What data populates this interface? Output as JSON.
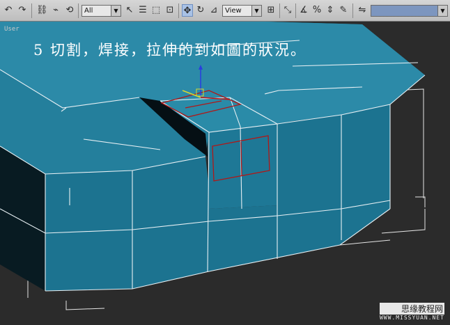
{
  "toolbar": {
    "icons": [
      "undo-icon",
      "redo-icon",
      "link-icon",
      "unlink-icon",
      "bind-spacewarp-icon",
      "select-icon",
      "select-by-name-icon",
      "region-select-icon",
      "window-crossing-icon",
      "move-icon",
      "rotate-icon",
      "scale-icon",
      "snap-icon",
      "spinner-snap-icon",
      "mirror-icon",
      "align-icon",
      "layer-icon",
      "curve-editor-icon"
    ],
    "selection_filter": "All",
    "reference_coord": "View",
    "named_selection": ""
  },
  "viewport": {
    "label": "User",
    "caption": "5  切割，焊接，拉伸的到如圖的狀況。"
  },
  "watermark": {
    "title": "思缘教程网",
    "url": "WWW.MISSYUAN.NET"
  },
  "colors": {
    "model_face": "#1d7895",
    "model_top": "#2a86a3",
    "wire": "#e8f0f4",
    "selected_edges": "#b01818",
    "background": "#2b2b2b"
  }
}
